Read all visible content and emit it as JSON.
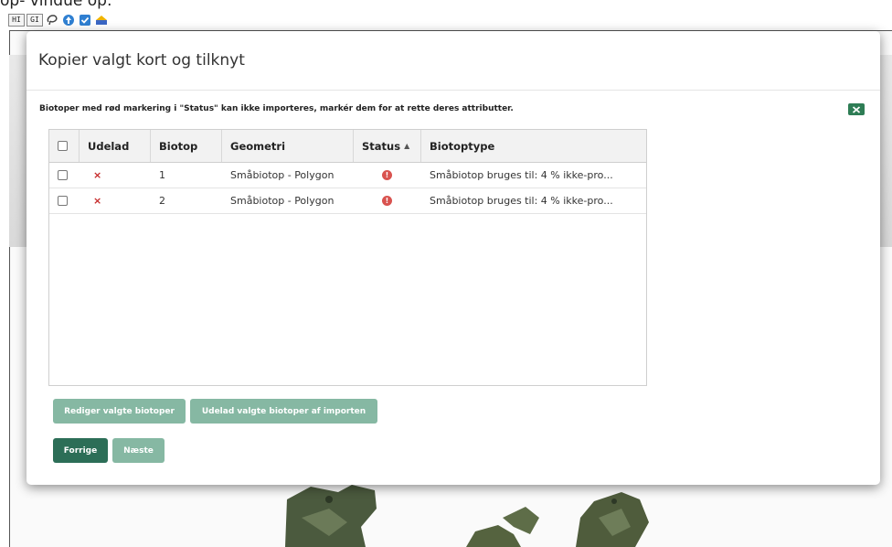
{
  "page": {
    "caption": "op- vindue op:",
    "toolbar": [
      {
        "label": "HI",
        "kind": "text"
      },
      {
        "label": "GI",
        "kind": "text"
      },
      {
        "icon": "lasso-icon"
      },
      {
        "icon": "arrow-up-circle-icon"
      },
      {
        "icon": "check-shield-icon"
      },
      {
        "icon": "layers-icon"
      }
    ]
  },
  "modal": {
    "title": "Kopier valgt kort og tilknyt",
    "warning": "Biotoper med rød markering i \"Status\" kan ikke importeres, markér dem for at rette deres attributter.",
    "export_icon": "excel-icon",
    "grid": {
      "columns": {
        "udelad": "Udelad",
        "biotop": "Biotop",
        "geometri": "Geometri",
        "status": "Status",
        "biotoptype": "Biotoptype"
      },
      "sort_column": "status",
      "sort_direction": "ascending",
      "rows": [
        {
          "udelad": "×",
          "biotop": "1",
          "geometri": "Småbiotop - Polygon",
          "status": "!",
          "biotoptype": "Småbiotop bruges til: 4 % ikke-pro..."
        },
        {
          "udelad": "×",
          "biotop": "2",
          "geometri": "Småbiotop - Polygon",
          "status": "!",
          "biotoptype": "Småbiotop bruges til: 4 % ikke-pro..."
        }
      ]
    },
    "buttons": {
      "edit": "Rediger valgte biotoper",
      "exclude": "Udelad valgte biotoper af importen",
      "prev": "Forrige",
      "next": "Næste"
    }
  },
  "colors": {
    "primary": "#2c6e57",
    "primary_muted": "#86b8a3",
    "error": "#d9534f",
    "remove": "#c62828"
  }
}
